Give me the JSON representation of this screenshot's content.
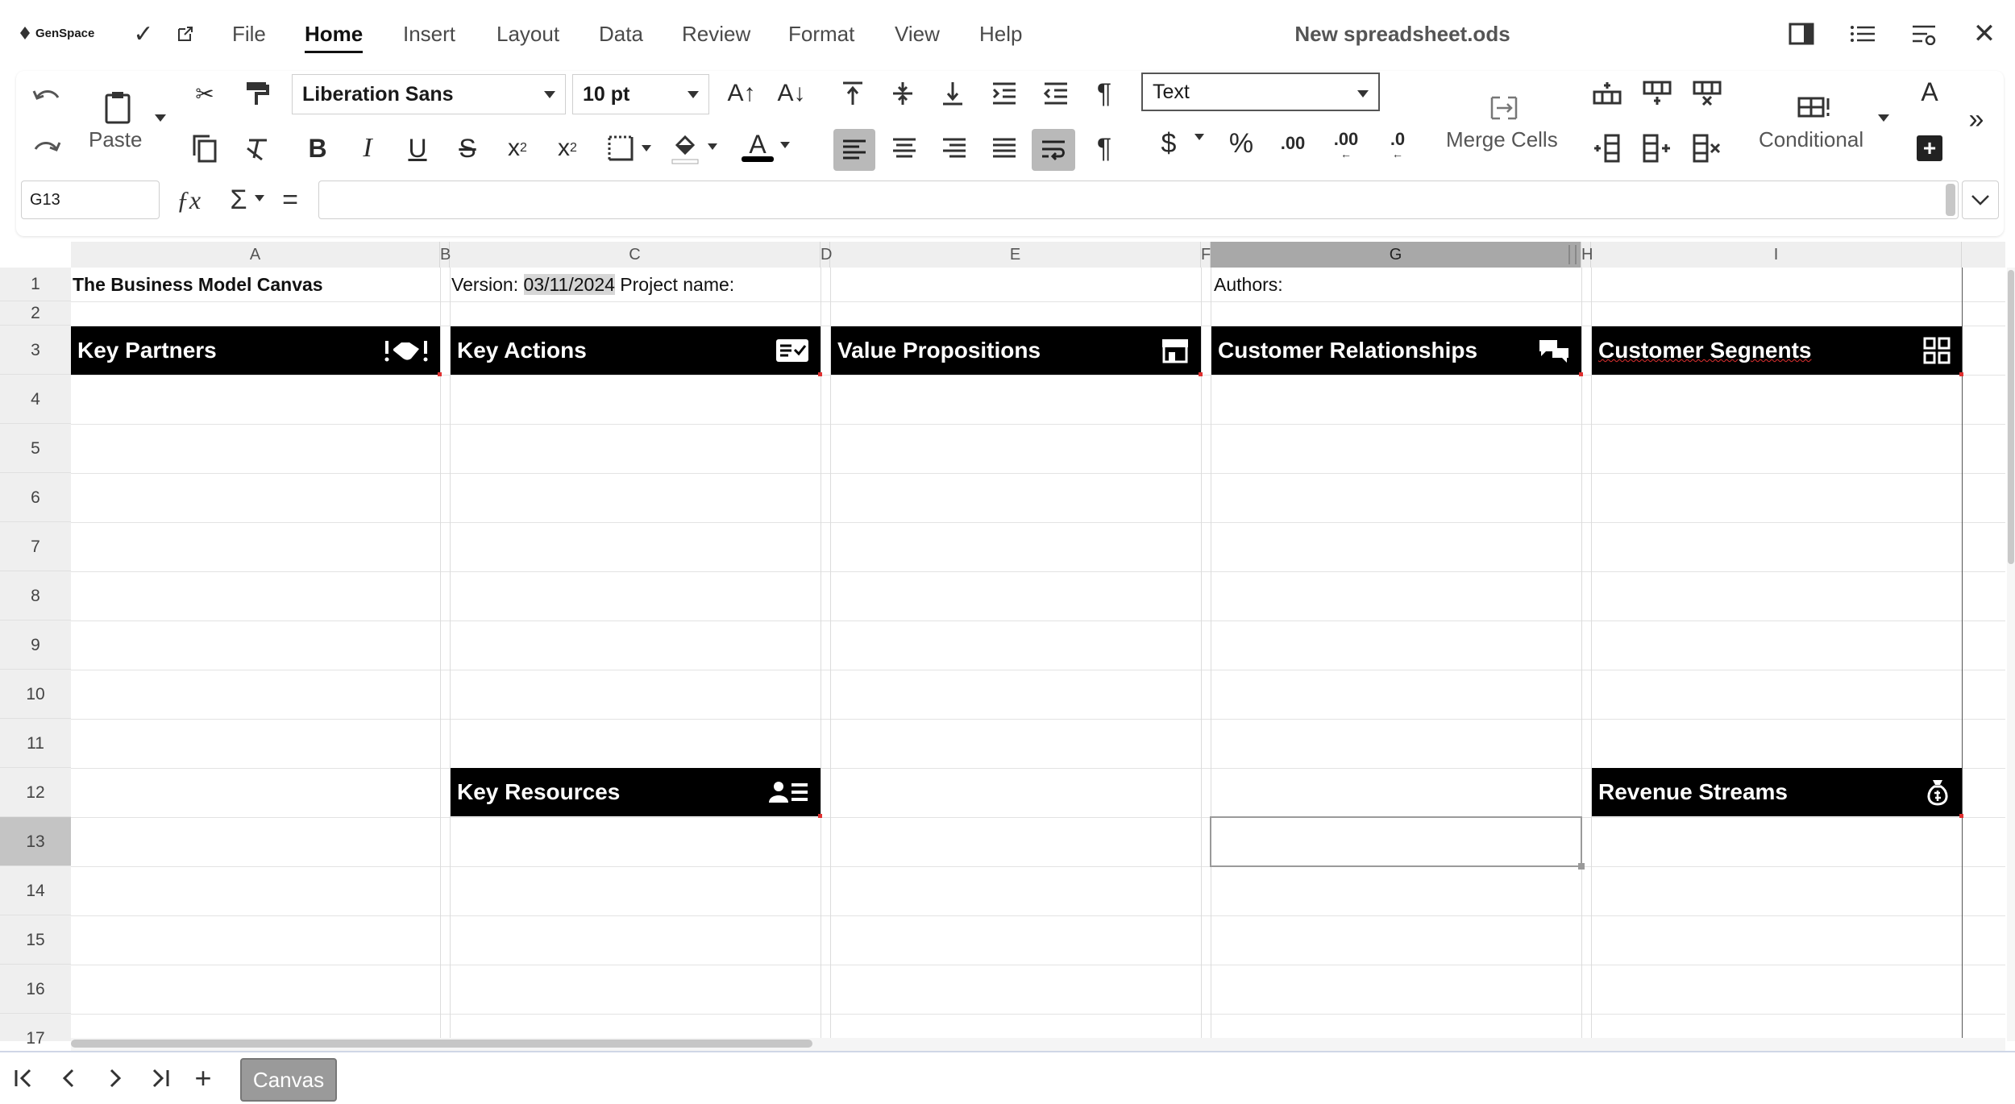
{
  "app": {
    "logo_text": "GenSpace",
    "document_title": "New spreadsheet.ods"
  },
  "menu": {
    "items": [
      "File",
      "Home",
      "Insert",
      "Layout",
      "Data",
      "Review",
      "Format",
      "View",
      "Help"
    ],
    "active": "Home"
  },
  "toolbar": {
    "paste_label": "Paste",
    "font_name": "Liberation Sans",
    "font_size": "10 pt",
    "number_format": "Text",
    "merge_cells_label": "Merge Cells",
    "conditional_label": "Conditional",
    "decimal_add_label": ".00",
    "decimal_remove_label": ".00",
    "decimal_zero_label": ".0"
  },
  "formula_bar": {
    "cell_reference": "G13",
    "formula_value": ""
  },
  "sheet": {
    "columns": [
      "A",
      "B",
      "C",
      "D",
      "E",
      "F",
      "G",
      "H",
      "I"
    ],
    "selected_column": "G",
    "rows": [
      "1",
      "2",
      "3",
      "4",
      "5",
      "6",
      "7",
      "8",
      "9",
      "10",
      "11",
      "12",
      "13",
      "14",
      "15",
      "16",
      "17"
    ],
    "selected_row": "13",
    "cells": {
      "a1": "The Business Model Canvas",
      "c1_prefix": "Version: ",
      "c1_date": "03/11/2024",
      "c1_suffix": " Project name:",
      "g1": "Authors:"
    },
    "headers": {
      "key_partners": "Key Partners",
      "key_actions": "Key Actions",
      "value_propositions": "Value Propositions",
      "customer_relationships": "Customer Relationships",
      "customer_segments": "Customer Segnents",
      "key_resources": "Key Resources",
      "revenue_streams": "Revenue Streams"
    }
  },
  "tabs": {
    "sheets": [
      "Canvas"
    ],
    "active": "Canvas"
  }
}
